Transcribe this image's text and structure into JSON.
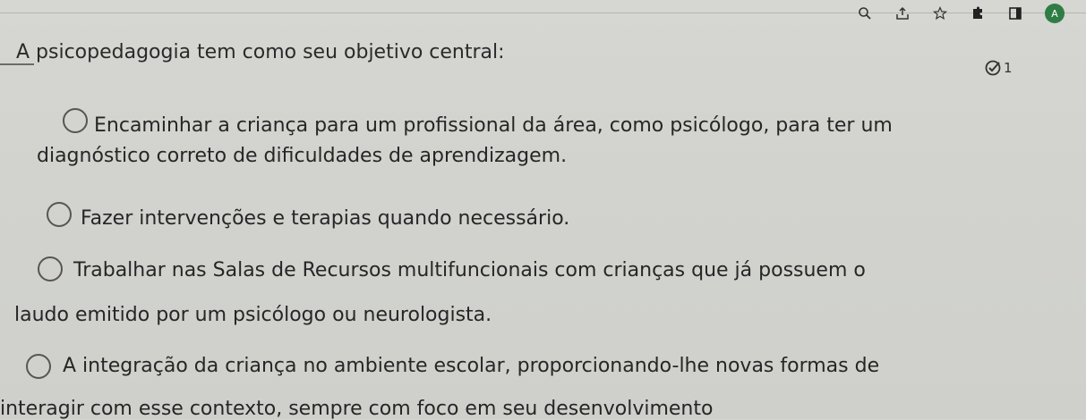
{
  "toolbar": {
    "icons": [
      "zoom-icon",
      "share-icon",
      "star-icon",
      "extension-icon",
      "sidebar-icon",
      "profile-avatar"
    ],
    "avatar_letter": "A"
  },
  "question": {
    "text": "A psicopedagogia tem como seu objetivo central:",
    "attempts_count": "1"
  },
  "options": [
    {
      "line1": "Encaminhar a criança para um profissional da área, como psicólogo, para ter um",
      "line2": "diagnóstico correto de dificuldades de aprendizagem."
    },
    {
      "line1": "Fazer intervenções e terapias quando necessário."
    },
    {
      "line1": "Trabalhar nas Salas de Recursos multifuncionais com crianças que já possuem o",
      "line2": "laudo emitido por um psicólogo ou neurologista."
    },
    {
      "line1": "A integração da criança no ambiente escolar, proporcionando-lhe novas formas de",
      "line2": "interagir com esse contexto, sempre com foco em seu desenvolvimento"
    }
  ]
}
